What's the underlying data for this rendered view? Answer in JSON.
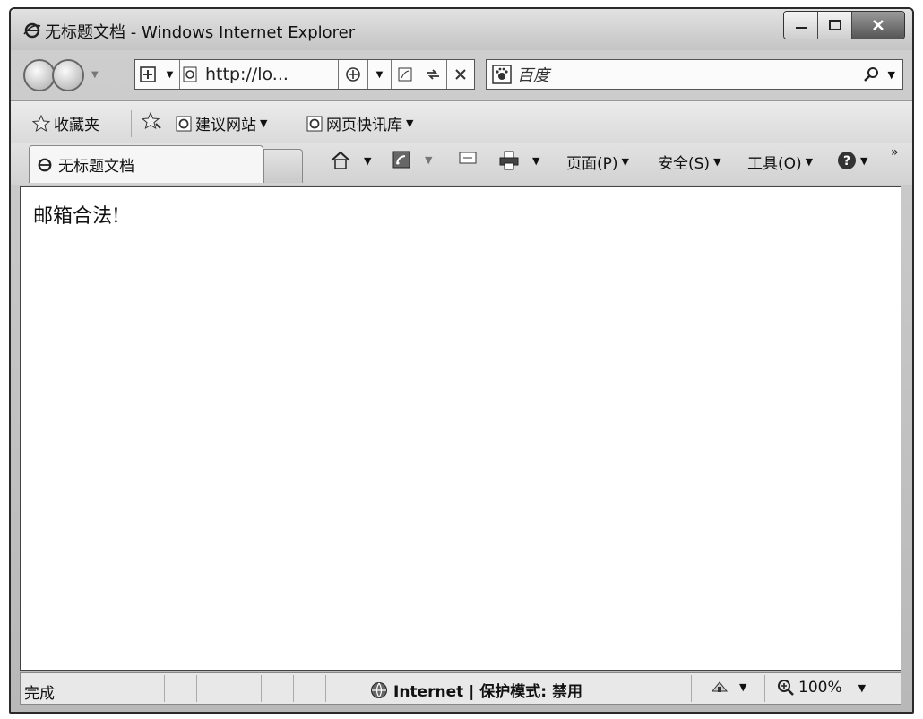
{
  "window": {
    "title": "无标题文档 - Windows Internet Explorer"
  },
  "address_bar": {
    "url": "http://lo..."
  },
  "search": {
    "placeholder": "百度"
  },
  "favorites_bar": {
    "favorites_label": "收藏夹",
    "items": [
      {
        "label": "建议网站"
      },
      {
        "label": "网页快讯库"
      }
    ]
  },
  "tabs": [
    {
      "label": "无标题文档"
    }
  ],
  "command_bar": {
    "page_label": "页面(P)",
    "safety_label": "安全(S)",
    "tools_label": "工具(O)",
    "overflow_label": "»"
  },
  "content": {
    "text": "邮箱合法!"
  },
  "status_bar": {
    "status_text": "完成",
    "zone_label": "Internet | 保护模式: 禁用",
    "zoom_label": "100%"
  },
  "icons": [
    "ie-logo-icon",
    "back-icon",
    "forward-icon",
    "refresh-icon",
    "stop-icon",
    "search-icon",
    "star-icon",
    "home-icon",
    "rss-icon",
    "mail-icon",
    "print-icon",
    "help-icon",
    "globe-icon"
  ]
}
